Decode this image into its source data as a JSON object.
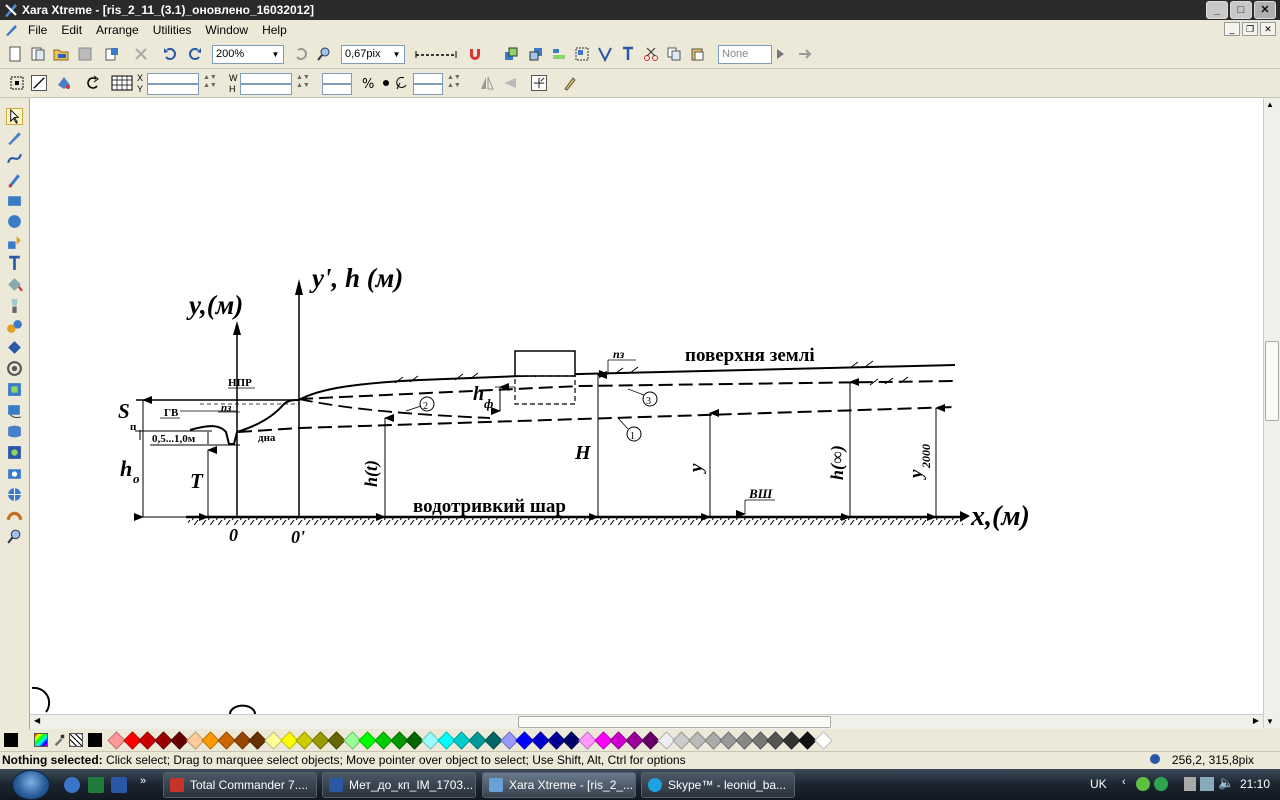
{
  "window": {
    "title": "Xara Xtreme - [ris_2_11_(3.1)_оновлено_16032012]",
    "buttons": {
      "minimize": "_",
      "maximize": "□",
      "close": "✕"
    }
  },
  "menu": {
    "items": [
      "File",
      "Edit",
      "Arrange",
      "Utilities",
      "Window",
      "Help"
    ]
  },
  "toolbar1": {
    "zoom": "200%",
    "line_width": "0,67pix",
    "fill": "None"
  },
  "toolbar2": {
    "x_label": "X",
    "y_label": "Y",
    "w_label": "W",
    "h_label": "H"
  },
  "drawing": {
    "y_axis_left": "y,(м)",
    "y_axis_right": "y', h (м)",
    "x_axis": "x,(м)",
    "ground_surface": "поверхня землі",
    "aquitard": "водотривкий шар",
    "npr": "НПР",
    "pz_left": "пз",
    "pz_right": "пз",
    "gv": "ГВ",
    "range": "0,5...1,0м",
    "dna": "дна",
    "s_label": "S",
    "s_sub": "п",
    "h0": "h",
    "h0_sub": "o",
    "t_label": "T",
    "ht": "h(t)",
    "H": "H",
    "hf": "h",
    "hf_sub": "ф",
    "y_mid": "y",
    "hinf": "h(∞)",
    "y2000": "y",
    "y2000_sub": "2000",
    "vsh": "ВШ",
    "origin": "0",
    "origin_prime": "0'",
    "c1": "1",
    "c2": "2",
    "c3": "3"
  },
  "status": {
    "bold": "Nothing selected:",
    "text": " Click select; Drag to marquee select objects; Move pointer over object to select; Use Shift, Alt, Ctrl for options",
    "coords": "256,2, 315,8pix"
  },
  "taskbar": {
    "tasks": [
      "Total Commander 7....",
      "Мет_до_кп_ІМ_1703...",
      "Xara Xtreme - [ris_2_...",
      "Skype™ - leonid_ba..."
    ],
    "lang": "UK",
    "time": "21:10"
  },
  "colors": {
    "palette": [
      "#ff9999",
      "#ff0000",
      "#cc0000",
      "#990000",
      "#660000",
      "#ffcc99",
      "#ff9900",
      "#cc6600",
      "#994400",
      "#663300",
      "#ffff99",
      "#ffff00",
      "#cccc00",
      "#999900",
      "#666600",
      "#99ff99",
      "#00ff00",
      "#00cc00",
      "#009900",
      "#006600",
      "#99ffff",
      "#00ffff",
      "#00cccc",
      "#009999",
      "#006666",
      "#9999ff",
      "#0000ff",
      "#0000cc",
      "#000099",
      "#000066",
      "#ff99ff",
      "#ff00ff",
      "#cc00cc",
      "#990099",
      "#660066",
      "#eeeeee",
      "#cccccc",
      "#bbbbbb",
      "#aaaaaa",
      "#999999",
      "#888888",
      "#777777",
      "#555555",
      "#333333",
      "#111111",
      "#ffffff"
    ]
  }
}
